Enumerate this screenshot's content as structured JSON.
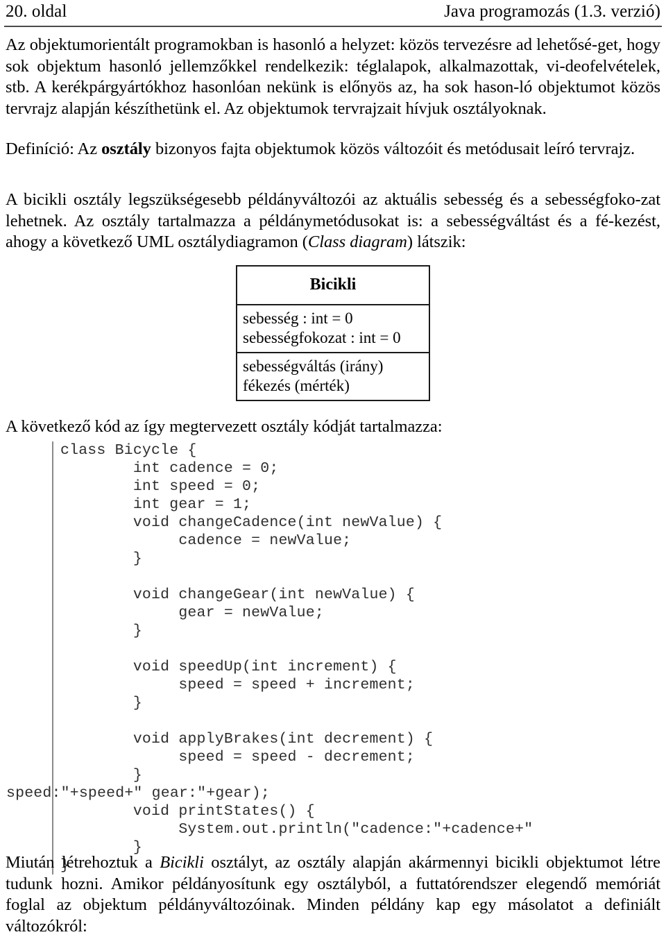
{
  "header": {
    "page_label": "20. oldal",
    "book_title": "Java programozás (1.3. verzió)"
  },
  "paragraphs": {
    "intro_1": "Az objektumorientált programokban is hasonló a helyzet: közös tervezésre ad lehetősé-get, hogy sok objektum hasonló jellemzőkkel rendelkezik: téglalapok, alkalmazottak, vi-deofelvételek, stb. A kerékpárgyártókhoz hasonlóan nekünk is előnyös az, ha sok hason-ló objektumot közös tervrajz alapján készíthetünk el. Az objektumok tervrajzait hívjuk osztályoknak.",
    "definition_prefix": "Definíció: Az ",
    "definition_bold": "osztály",
    "definition_suffix": " bizonyos fajta objektumok közös változóit és metódusait leíró tervrajz.",
    "bicikli_prefix": "A bicikli osztály legszükségesebb példányváltozói az aktuális sebesség és a sebességfoko-zat lehetnek. Az osztály tartalmazza a példánymetódusokat is: a sebességváltást és a fé-kezést, ahogy a következő UML osztálydiagramon (",
    "bicikli_italic": "Class diagram",
    "bicikli_suffix": ") látszik:",
    "code_lead": "A következő kód az így megtervezett osztály kódját tartalmazza:",
    "closing_prefix": "Miután létrehoztuk a ",
    "closing_italic": "Bicikli",
    "closing_suffix": " osztályt, az osztály alapján akármennyi bicikli objektumot létre tudunk hozni. Amikor példányosítunk egy osztályból, a futtatórendszer elegendő memóriát foglal az objektum példányváltozóinak. Minden példány kap egy másolatot a definiált változókról:"
  },
  "uml_diagram": {
    "class_name": "Bicikli",
    "attributes": [
      "sebesség : int = 0",
      "sebességfokozat : int = 0"
    ],
    "operations": [
      "sebességváltás (irány)",
      "fékezés (mérték)"
    ]
  },
  "code": {
    "language": "java",
    "main_text": "class Bicycle {\n        int cadence = 0;\n        int speed = 0;\n        int gear = 1;\n        void changeCadence(int newValue) {\n             cadence = newValue;\n        }\n\n        void changeGear(int newValue) {\n             gear = newValue;\n        }\n\n        void speedUp(int increment) {\n             speed = speed + increment;\n        }\n\n        void applyBrakes(int decrement) {\n             speed = speed - decrement;\n        }\n\n        void printStates() {\n             System.out.println(\"cadence:\"+cadence+\"",
    "wrapped_continuation": "speed:\"+speed+\" gear:\"+gear);",
    "tail_text": "        }\n}"
  },
  "colors": {
    "text": "#000000",
    "code_text": "#2e2e2e",
    "rule": "#4a4a4a",
    "code_rule": "#8a8a8a",
    "box_border": "#1a1a1a"
  }
}
